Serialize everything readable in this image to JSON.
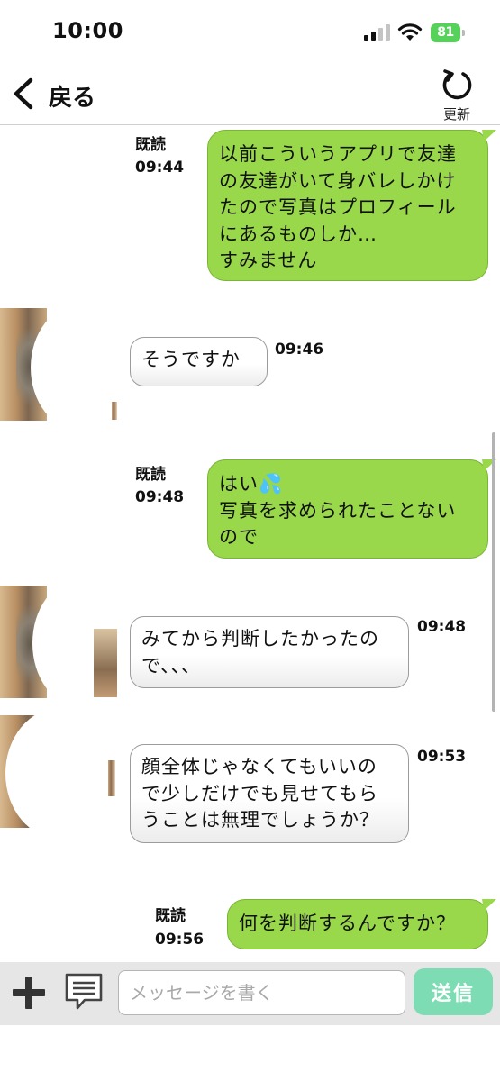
{
  "status_bar": {
    "time": "10:00",
    "battery": "81"
  },
  "header": {
    "back_label": "戻る",
    "refresh_label": "更新"
  },
  "messages": [
    {
      "direction": "sent",
      "text": "以前こういうアプリで友達\nの友達がいて身バレしかけ\nたので写真はプロフィール\nにあるものしか…\nすみません",
      "read": "既読",
      "time": "09:44"
    },
    {
      "direction": "received",
      "text": "そうですか",
      "time": "09:46"
    },
    {
      "direction": "sent",
      "text": "はい💦\n写真を求められたことない\nので",
      "read": "既読",
      "time": "09:48"
    },
    {
      "direction": "received",
      "text": "みてから判断したかったの\nで、、、",
      "time": "09:48"
    },
    {
      "direction": "received",
      "text": "顔全体じゃなくてもいいの\nで少しだけでも見せてもら\nうことは無理でしょうか？",
      "time": "09:53"
    },
    {
      "direction": "sent",
      "text": "何を判断するんですか？",
      "read": "既読",
      "time": "09:56"
    }
  ],
  "input_bar": {
    "placeholder": "メッセージを書く",
    "send_label": "送信"
  },
  "colors": {
    "sent_bubble": "#98d84a",
    "send_button": "#7ddcb4",
    "battery": "#56d15a"
  },
  "icons": [
    "back-chevron-icon",
    "refresh-icon",
    "plus-icon",
    "message-template-icon",
    "signal-icon",
    "wifi-icon",
    "battery-icon"
  ]
}
